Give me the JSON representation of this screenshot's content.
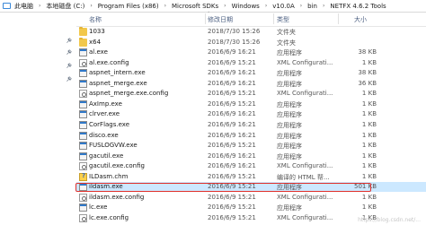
{
  "breadcrumb": [
    "此电脑",
    "本地磁盘 (C:)",
    "Program Files (x86)",
    "Microsoft SDKs",
    "Windows",
    "v10.0A",
    "bin",
    "NETFX 4.6.2 Tools"
  ],
  "columns": {
    "name": "名称",
    "date": "修改日期",
    "type": "类型",
    "size": "大小"
  },
  "files": [
    {
      "name": "1033",
      "date": "2018/7/30 15:26",
      "type": "文件夹",
      "size": "",
      "icon": "folder-icon"
    },
    {
      "name": "x64",
      "date": "2018/7/30 15:26",
      "type": "文件夹",
      "size": "",
      "icon": "folder-icon"
    },
    {
      "name": "al.exe",
      "date": "2016/6/9 16:21",
      "type": "应用程序",
      "size": "38 KB",
      "icon": "exe-icon"
    },
    {
      "name": "al.exe.config",
      "date": "2016/6/9 15:21",
      "type": "XML Configurati...",
      "size": "1 KB",
      "icon": "config-icon"
    },
    {
      "name": "aspnet_intern.exe",
      "date": "2016/6/9 16:21",
      "type": "应用程序",
      "size": "38 KB",
      "icon": "exe-icon"
    },
    {
      "name": "aspnet_merge.exe",
      "date": "2016/6/9 16:21",
      "type": "应用程序",
      "size": "36 KB",
      "icon": "exe-icon"
    },
    {
      "name": "aspnet_merge.exe.config",
      "date": "2016/6/9 15:21",
      "type": "XML Configurati...",
      "size": "1 KB",
      "icon": "config-icon"
    },
    {
      "name": "AxImp.exe",
      "date": "2016/6/9 15:21",
      "type": "应用程序",
      "size": "1 KB",
      "icon": "exe-icon"
    },
    {
      "name": "clrver.exe",
      "date": "2016/6/9 16:21",
      "type": "应用程序",
      "size": "1 KB",
      "icon": "exe-icon"
    },
    {
      "name": "CorFlags.exe",
      "date": "2016/6/9 16:21",
      "type": "应用程序",
      "size": "1 KB",
      "icon": "exe-icon"
    },
    {
      "name": "disco.exe",
      "date": "2016/6/9 16:21",
      "type": "应用程序",
      "size": "1 KB",
      "icon": "exe-icon"
    },
    {
      "name": "FUSLOGVW.exe",
      "date": "2016/6/9 15:21",
      "type": "应用程序",
      "size": "1 KB",
      "icon": "exe-icon"
    },
    {
      "name": "gacutil.exe",
      "date": "2016/6/9 16:21",
      "type": "应用程序",
      "size": "1 KB",
      "icon": "exe-icon"
    },
    {
      "name": "gacutil.exe.config",
      "date": "2016/6/9 16:21",
      "type": "XML Configurati...",
      "size": "1 KB",
      "icon": "config-icon"
    },
    {
      "name": "ILDasm.chm",
      "date": "2016/6/9 15:21",
      "type": "编译的 HTML 帮...",
      "size": "1 KB",
      "icon": "chm-icon"
    },
    {
      "name": "ildasm.exe",
      "date": "2016/6/9 15:21",
      "type": "应用程序",
      "size": "501 KB",
      "icon": "exe-icon"
    },
    {
      "name": "ildasm.exe.config",
      "date": "2016/6/9 15:21",
      "type": "XML Configurati...",
      "size": "1 KB",
      "icon": "config-icon"
    },
    {
      "name": "lc.exe",
      "date": "2016/6/9 15:21",
      "type": "应用程序",
      "size": "1 KB",
      "icon": "exe-icon"
    },
    {
      "name": "lc.exe.config",
      "date": "2016/6/9 15:21",
      "type": "XML Configurati...",
      "size": "1 KB",
      "icon": "config-icon"
    }
  ],
  "selected_index": 15,
  "highlight_color": "#e0312c",
  "selection_color": "#cce8ff",
  "watermark": "https://blog.csdn.net/..."
}
